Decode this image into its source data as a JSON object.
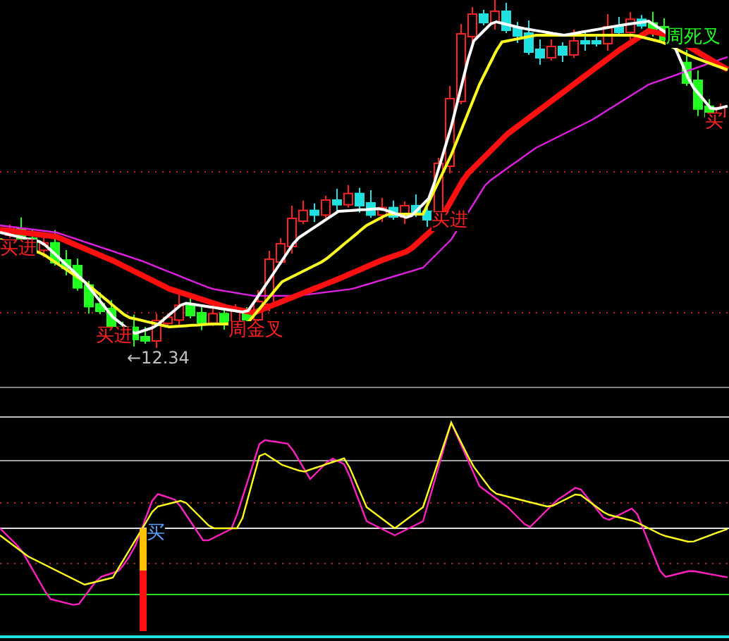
{
  "main_panel": {
    "signals": [
      {
        "text": "买进",
        "color": "#ff2020"
      },
      {
        "text": "买进",
        "color": "#ff2020"
      },
      {
        "text": "周金叉",
        "color": "#ff2020"
      },
      {
        "text": "买进",
        "color": "#ff2020"
      },
      {
        "text": "周死叉",
        "color": "#20ff20"
      },
      {
        "text": "买",
        "color": "#ff2020"
      }
    ],
    "low_marker": "←12.34"
  },
  "indicator_panel": {
    "signals": [
      {
        "text": "买",
        "color": "#5aa0ff"
      }
    ]
  }
}
